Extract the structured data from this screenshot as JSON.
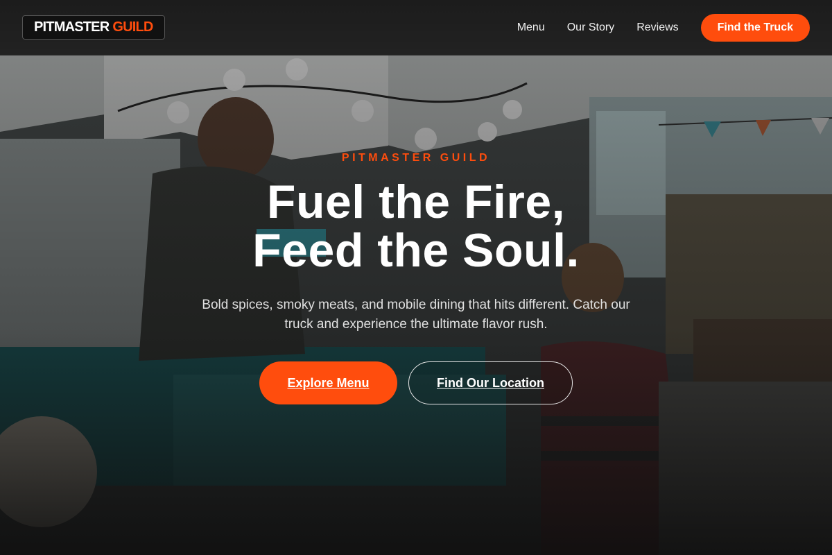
{
  "header": {
    "logo_word1": "PITMASTER",
    "logo_word2": "GUILD",
    "nav": [
      "Menu",
      "Our Story",
      "Reviews"
    ],
    "cta": "Find the Truck"
  },
  "hero": {
    "eyebrow": "PITMASTER GUILD",
    "headline_line1": "Fuel the Fire,",
    "headline_line2": "Feed the Soul.",
    "subtitle": "Bold spices, smoky meats, and mobile dining that hits different. Catch our truck and experience the ultimate flavor rush.",
    "primary_button": "Explore Menu",
    "secondary_button": "Find Our Location"
  },
  "colors": {
    "accent": "#ff4d0d",
    "header_bg": "#1c1c1c",
    "text": "#ffffff"
  }
}
